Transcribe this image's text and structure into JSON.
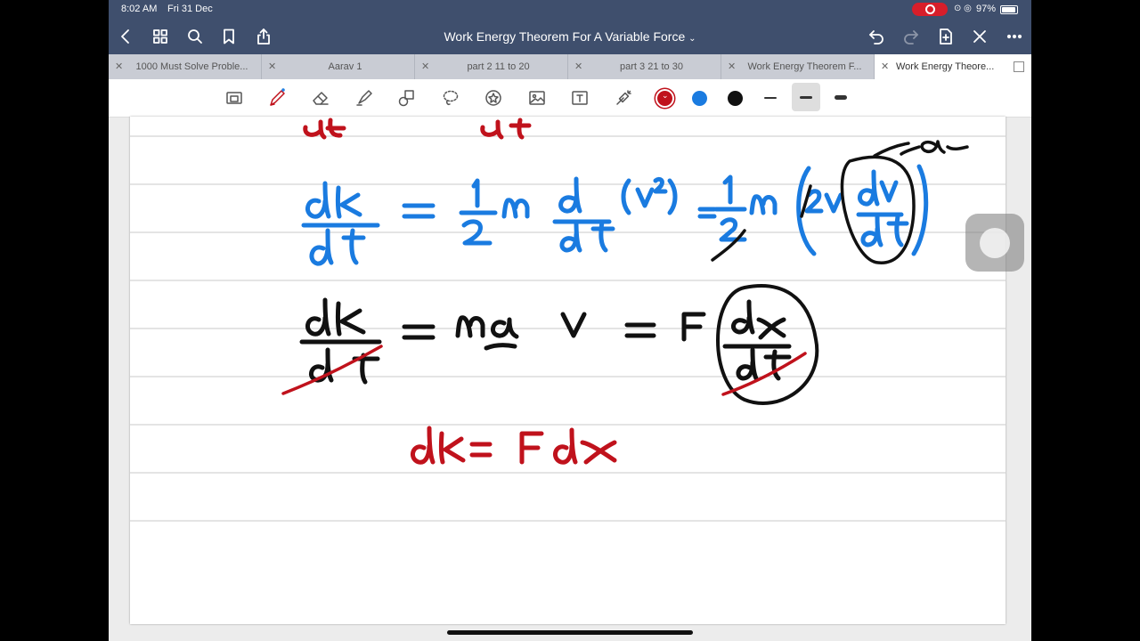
{
  "status_bar": {
    "time": "8:02 AM",
    "date": "Fri 31 Dec",
    "battery": "97%",
    "battery_level": 0.97,
    "icons": [
      "wifi-icon",
      "location-icon",
      "battery-icon"
    ]
  },
  "nav": {
    "title": "Work Energy Theorem For A Variable Force",
    "icons_left": [
      "back-icon",
      "grid-icon",
      "search-icon",
      "bookmark-icon",
      "share-icon"
    ],
    "icons_right": [
      "undo-icon",
      "redo-icon",
      "add-page-icon",
      "close-icon",
      "more-icon"
    ]
  },
  "tabs": [
    {
      "label": "1000 Must Solve Proble...",
      "active": false
    },
    {
      "label": "Aarav 1",
      "active": false
    },
    {
      "label": "part 2  11 to 20",
      "active": false
    },
    {
      "label": "part 3  21 to 30",
      "active": false
    },
    {
      "label": "Work Energy Theorem F...",
      "active": false
    },
    {
      "label": "Work Energy Theore...",
      "active": true
    }
  ],
  "toolbar": {
    "tools": [
      "zoom-window-icon",
      "pen-icon",
      "eraser-icon",
      "highlighter-icon",
      "shapes-icon",
      "lasso-icon",
      "sticker-icon",
      "image-icon",
      "text-icon",
      "laser-pointer-icon"
    ],
    "selected_tool": "pen-icon",
    "colors": [
      "#c0121c",
      "#1a7be0",
      "#111111"
    ],
    "selected_color": "#c0121c",
    "stroke_widths": [
      "thin",
      "medium",
      "thick"
    ],
    "selected_stroke": "medium"
  },
  "note": {
    "handwritten_lines": [
      "dK/dt = 1/2 m d/dt (v²) = 1/2 m (2v dv/dt) a",
      "dK/dt = m a v = F dx/dt",
      "dK = F dx"
    ]
  }
}
